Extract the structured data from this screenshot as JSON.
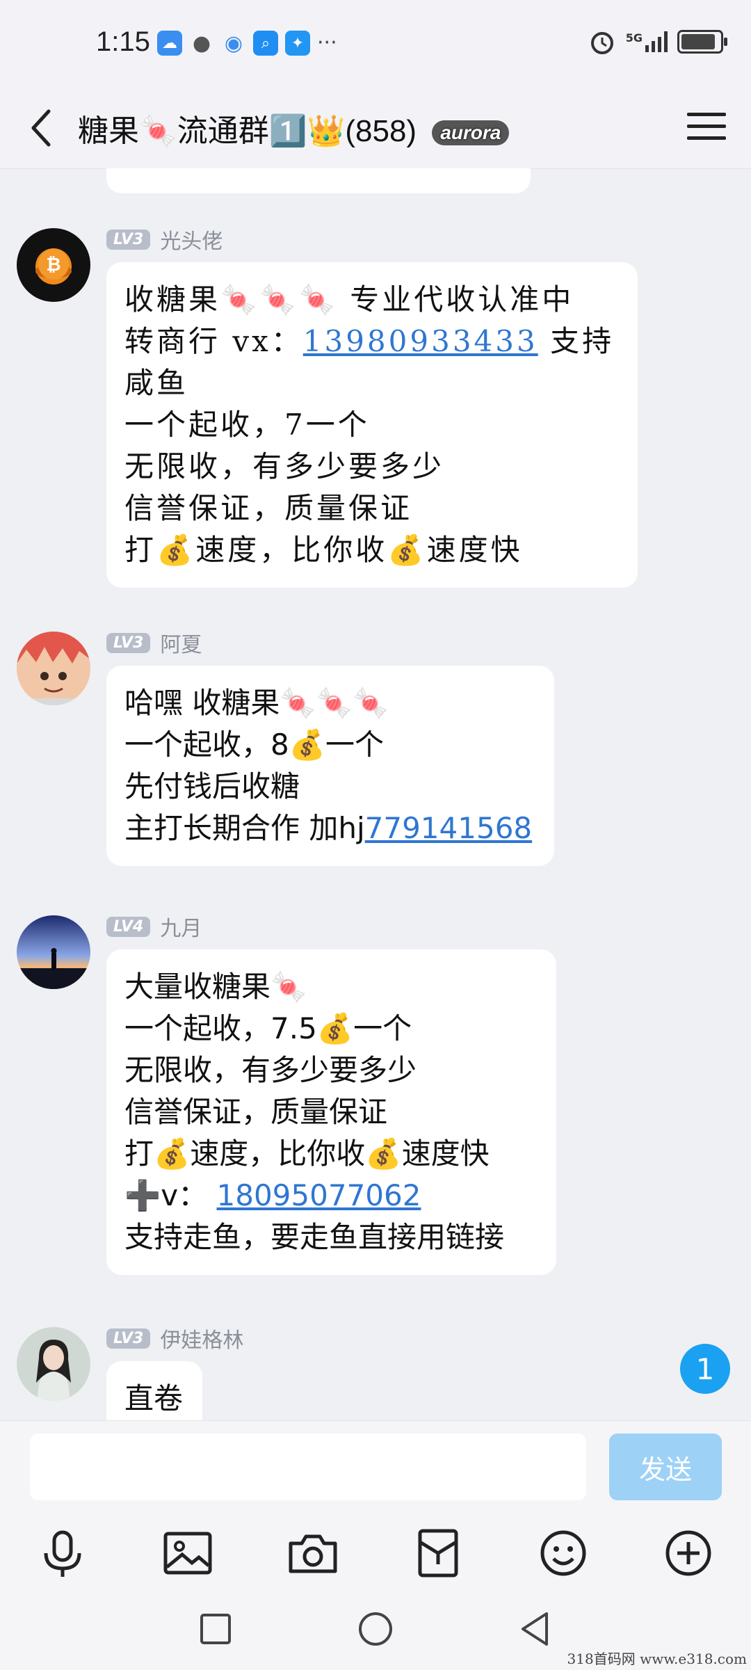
{
  "status": {
    "time": "1:15",
    "more": "···",
    "network": "5G"
  },
  "header": {
    "title": "糖果🍬流通群1️⃣👑(858)",
    "badge": "aurora"
  },
  "messages": [
    {
      "level": "LV3",
      "name": "光头佬",
      "lines": [
        "收糖果🍬🍬🍬 专业代收认准中",
        "转商行 vx：",
        "13980933433",
        "支持",
        "咸鱼",
        " 一个起收，7一个",
        "无限收，有多少要多少",
        "信誉保证，质量保证",
        "打💰速度，比你收💰速度快"
      ]
    },
    {
      "level": "LV3",
      "name": "阿夏",
      "lines": [
        "哈嘿 收糖果🍬🍬🍬",
        "一个起收，8💰一个",
        "先付钱后收糖",
        "主打长期合作 加hj",
        "779141568"
      ]
    },
    {
      "level": "LV4",
      "name": "九月",
      "lines": [
        "大量收糖果🍬",
        " 一个起收，7.5💰一个",
        "无限收，有多少要多少",
        "信誉保证，质量保证",
        "打💰速度，比你收💰速度快",
        "➕v：",
        "18095077062",
        "支持走鱼，要走鱼直接用链接"
      ]
    },
    {
      "level": "LV3",
      "name": "伊娃格林",
      "lines": [
        "直卷"
      ]
    }
  ],
  "unread_count": "1",
  "composer": {
    "send_label": "发送"
  },
  "watermark": "318首码网 www.e318.com"
}
